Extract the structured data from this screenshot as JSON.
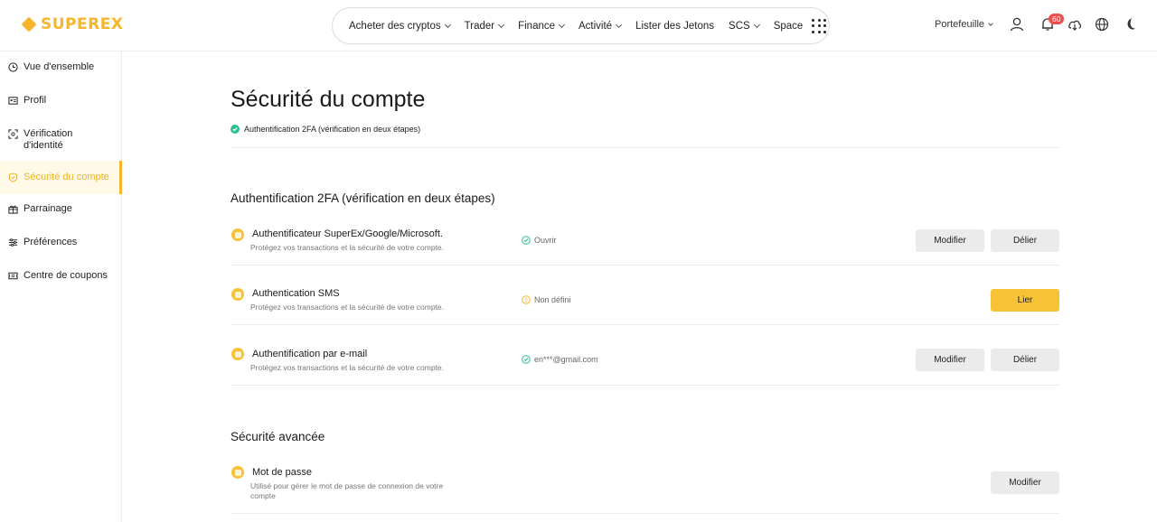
{
  "header": {
    "logo": "SUPEREX",
    "nav": [
      {
        "label": "Acheter des cryptos",
        "dropdown": true
      },
      {
        "label": "Trader",
        "dropdown": true
      },
      {
        "label": "Finance",
        "dropdown": true
      },
      {
        "label": "Activité",
        "dropdown": true
      },
      {
        "label": "Lister des Jetons",
        "dropdown": false
      },
      {
        "label": "SCS",
        "dropdown": true
      },
      {
        "label": "Space",
        "dropdown": false
      }
    ],
    "wallet_label": "Portefeuille",
    "notification_count": "60"
  },
  "sidebar": {
    "items": [
      {
        "label": "Vue d'ensemble",
        "icon": "clock-icon"
      },
      {
        "label": "Profil",
        "icon": "id-card-icon"
      },
      {
        "label": "Vérification d'identité",
        "icon": "scan-face-icon"
      },
      {
        "label": "Sécurité du compte",
        "icon": "shield-icon",
        "active": true
      },
      {
        "label": "Parrainage",
        "icon": "gift-icon"
      },
      {
        "label": "Préférences",
        "icon": "sliders-icon"
      },
      {
        "label": "Centre de coupons",
        "icon": "coupon-icon"
      }
    ]
  },
  "main": {
    "title": "Sécurité du compte",
    "subtitle": "Authentification 2FA (vérification en deux étapes)",
    "section_2fa": {
      "title": "Authentification 2FA (vérification en deux étapes)",
      "rows": [
        {
          "title": "Authentificateur SuperEx/Google/Microsoft.",
          "desc": "Protégez vos transactions et la sécurité de votre compte.",
          "status": "Ouvrir",
          "status_kind": "ok",
          "buttons": [
            "Modifier",
            "Délier"
          ]
        },
        {
          "title": "Authentication SMS",
          "desc": "Protégez vos transactions et la sécurité de votre compte.",
          "status": "Non défini",
          "status_kind": "warn",
          "buttons": [
            "Lier"
          ]
        },
        {
          "title": "Authentification par e-mail",
          "desc": "Protégez vos transactions et la sécurité de votre compte.",
          "status": "en***@gmail.com",
          "status_kind": "ok",
          "buttons": [
            "Modifier",
            "Délier"
          ]
        }
      ]
    },
    "section_advanced": {
      "title": "Sécurité avancée",
      "rows": [
        {
          "title": "Mot de passe",
          "desc": "Utilisé pour gérer le mot de passe de connexion de votre compte",
          "buttons": [
            "Modifier"
          ]
        }
      ]
    }
  },
  "colors": {
    "brand": "#f7b52c",
    "ok": "#2fbf8f",
    "warn": "#f5b72e",
    "badge": "#f14e4e"
  }
}
